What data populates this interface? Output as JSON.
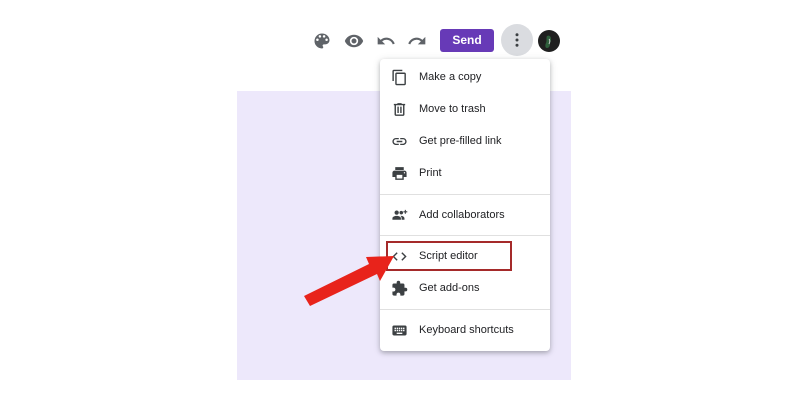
{
  "toolbar": {
    "icons": [
      "palette-icon",
      "eye-icon",
      "undo-icon",
      "redo-icon"
    ],
    "send_label": "Send",
    "more_icon": "more-vert-icon",
    "accent_color": "#673ab7"
  },
  "menu": {
    "items": [
      {
        "label": "Make a copy",
        "icon": "copy-icon"
      },
      {
        "label": "Move to trash",
        "icon": "trash-icon"
      },
      {
        "label": "Get pre-filled link",
        "icon": "link-icon"
      },
      {
        "label": "Print",
        "icon": "print-icon"
      },
      {
        "label": "Add collaborators",
        "icon": "add-people-icon"
      },
      {
        "label": "Script editor",
        "icon": "code-icon"
      },
      {
        "label": "Get add-ons",
        "icon": "puzzle-icon"
      },
      {
        "label": "Keyboard shortcuts",
        "icon": "keyboard-icon"
      }
    ]
  },
  "annotation": {
    "highlight_color": "#a52a2a",
    "arrow_color": "#e8231b"
  },
  "form_background_color": "#ede8fb"
}
